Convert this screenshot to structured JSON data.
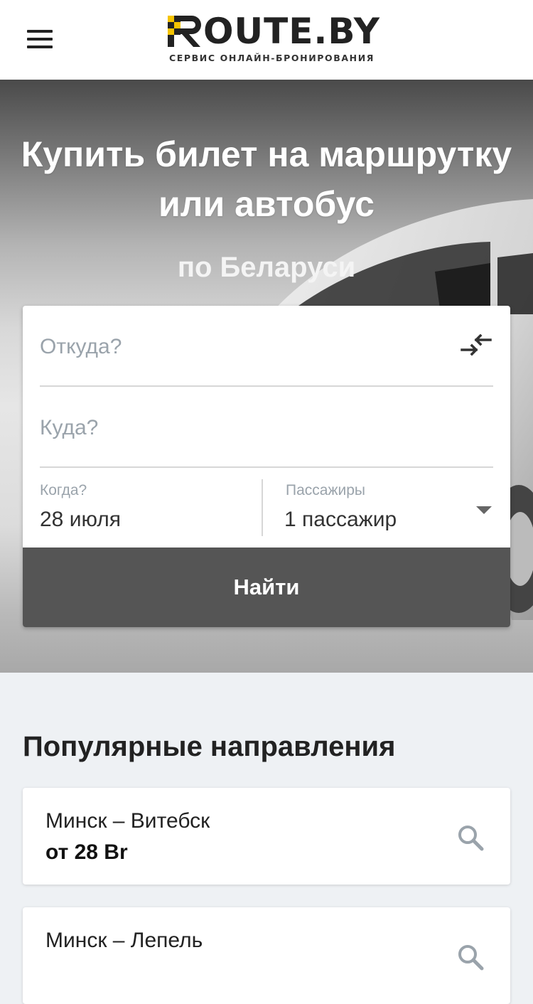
{
  "header": {
    "logo_text": "OUTE.BY",
    "logo_subtitle": "СЕРВИС ОНЛАЙН-БРОНИРОВАНИЯ",
    "menu_icon": "hamburger-menu-icon"
  },
  "hero": {
    "title_line1": "Купить билет на маршрутку",
    "title_line2": "или автобус",
    "subtitle": "по Беларуси"
  },
  "search_form": {
    "from_placeholder": "Откуда?",
    "to_placeholder": "Куда?",
    "swap_icon": "swap-arrows-icon",
    "date_label": "Когда?",
    "date_value": "28 июля",
    "passengers_label": "Пассажиры",
    "passengers_value": "1 пассажир",
    "find_label": "Найти"
  },
  "popular": {
    "heading": "Популярные направления",
    "routes": [
      {
        "route": "Минск – Витебск",
        "price": "от 28 Br"
      },
      {
        "route": "Минск – Лепель",
        "price": ""
      }
    ]
  },
  "colors": {
    "logo_yellow": "#f5c400",
    "button_gray": "#555555",
    "placeholder": "#9aa3ab",
    "page_bg": "#eef1f4"
  }
}
